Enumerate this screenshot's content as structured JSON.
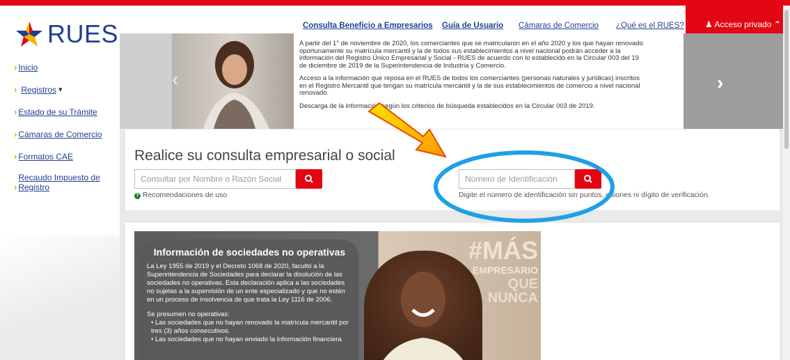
{
  "logo": {
    "text": "RUES"
  },
  "sidebar": {
    "items": [
      {
        "label": "Inicio"
      },
      {
        "label": "Registros",
        "suffix": "▾"
      },
      {
        "label": "Estado de su Trámite"
      },
      {
        "label": "Cámaras de Comercio"
      },
      {
        "label": "Formatos CAE"
      },
      {
        "label": "Recaudo Impuesto de Registro"
      }
    ]
  },
  "header": {
    "links": [
      {
        "label": "Consulta Beneficio a Empresarios"
      },
      {
        "label": "Guía de Usuario"
      },
      {
        "label": "Cámaras de Comercio"
      },
      {
        "label": "¿Qué es el RUES?"
      }
    ],
    "private_access": "Acceso privado"
  },
  "banner": {
    "p1": "A partir del 1° de noviembre de 2020, los comerciantes que se matricularon en el año 2020 y los que hayan renovado oportunamente su matrícula mercantil y la de todos sus establecimientos a nivel nacional podrán acceder a la información del Registro Único Empresarial y Social - RUES de acuerdo con lo establecido en la Circular 003 del 19 de diciembre de 2019 de la Superintendencia de Industria y Comercio.",
    "p2": "Acceso a la información que reposa en el RUES de todos los comerciantes (personas naturales y jurídicas) inscritos en el Registro Mercantil que tengan su matrícula mercantil y la de sus establecimientos de comercio a nivel nacional renovado.",
    "p3": "Descarga de la información según los criterios de búsqueda establecidos en la Circular 003 de 2019."
  },
  "search": {
    "title": "Realice su consulta empresarial o social",
    "name_placeholder": "Consultar por Nombre o Razón Social",
    "recommendations": "Recomendaciones de uso",
    "id_placeholder": "Número de Identificación",
    "id_help": "Digite el número de identificación sin puntos, guiones ni dígito de verificación."
  },
  "promo": {
    "title": "Información de sociedades no operativas",
    "p1": "La Ley 1955 de 2019 y el Decreto 1068 de 2020, facultó a la Superintendencia de Sociedades para declarar la disolución de las sociedades no operativas. Esta declaración aplica a las sociedades no sujetas a la supervisión de un ente especializado y que no estén en un proceso de insolvencia de que trata la Ley 1116 de 2006.",
    "p2": "Se presumen no operativas:",
    "b1": "• Las sociedades que no hayan renovado la matrícula mercantil por tres (3) años consecutivos.",
    "b2": "• Las sociedades que no hayan enviado la información financiera",
    "slogan1": "#MÁS",
    "slogan2": "EMPRESARIO",
    "slogan3": "QUE NUNCA"
  },
  "colors": {
    "brand_red": "#e30613",
    "brand_blue": "#1f3f8f",
    "accent_orange": "#f5a200",
    "highlight_circle": "#1ea0e6"
  }
}
